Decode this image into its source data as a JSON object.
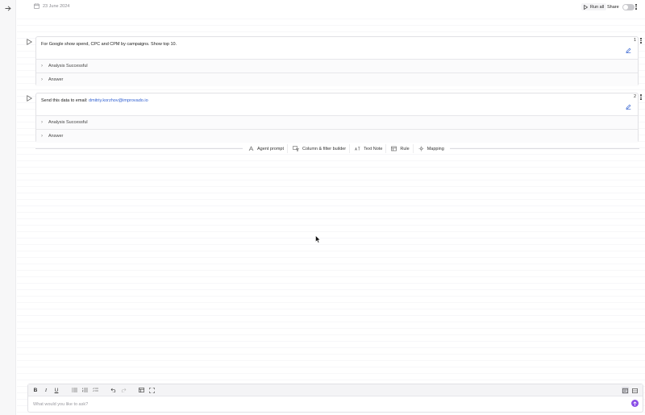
{
  "header": {
    "date": "23 June 2024",
    "run_all_label": "Run all",
    "share_label": "Share"
  },
  "cells": [
    {
      "number": "1",
      "prompt": "For Google show spend, CPC and CPM by campaigns. Show top 10.",
      "sections": [
        {
          "label": "Analysis Successful"
        },
        {
          "label": "Answer"
        }
      ]
    },
    {
      "number": "2",
      "prompt_prefix": "Send this data to email: ",
      "prompt_email": "dmitriy.korzhov@improvado.io",
      "sections": [
        {
          "label": "Analysis Successful"
        },
        {
          "label": "Answer"
        }
      ]
    }
  ],
  "add_bar": {
    "items": [
      {
        "label": "Agent prompt",
        "icon": "agent-icon"
      },
      {
        "label": "Column & filter builder",
        "icon": "filter-builder-icon"
      },
      {
        "label": "Text Note",
        "icon": "text-note-icon"
      },
      {
        "label": "Rule",
        "icon": "rule-icon"
      },
      {
        "label": "Mapping",
        "icon": "mapping-icon"
      }
    ]
  },
  "composer": {
    "placeholder": "What would you like to ask?",
    "toolbar_icons": [
      "bold-icon",
      "italic-icon",
      "underline-icon",
      "bullet-list-icon",
      "numbered-list-icon",
      "checklist-icon",
      "undo-icon",
      "redo-icon",
      "table-icon",
      "fullscreen-icon"
    ],
    "send_color": "#8a4de6"
  },
  "colors": {
    "accent": "#8a4de6",
    "link": "#2f5fd0",
    "edit_icon": "#2f5fd0"
  }
}
